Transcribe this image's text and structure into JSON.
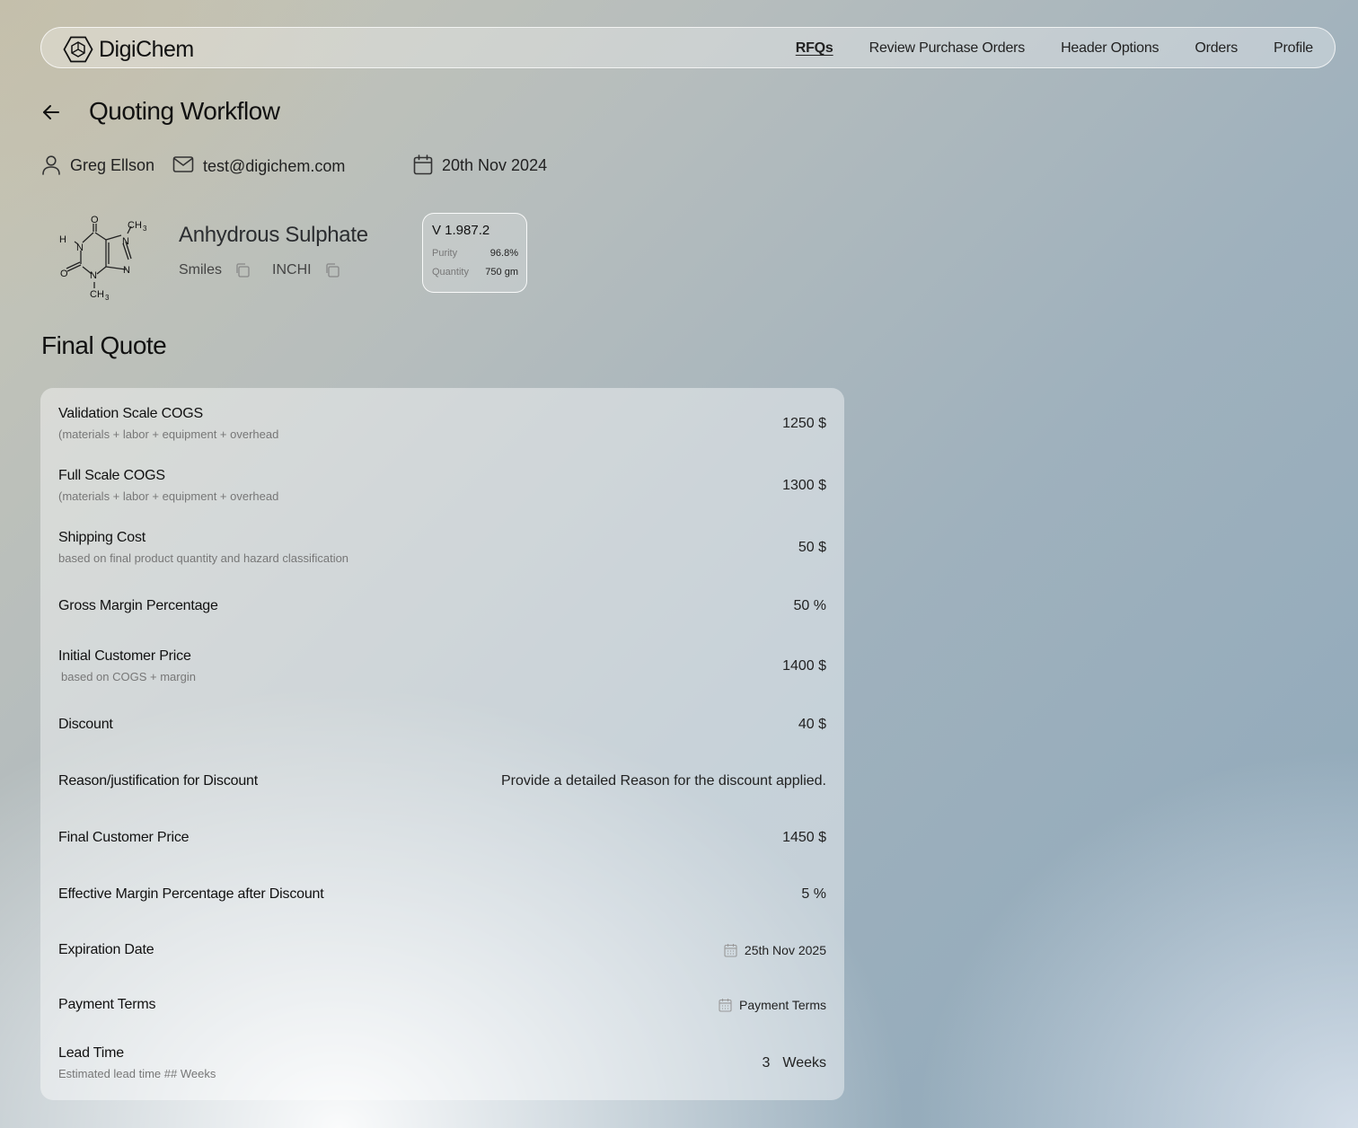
{
  "app": {
    "name": "DigiChem"
  },
  "nav": {
    "items": [
      "RFQs",
      "Review Purchase Orders",
      "Header Options",
      "Orders",
      "Profile"
    ]
  },
  "page": {
    "title": "Quoting Workflow"
  },
  "customer": {
    "name": "Greg Ellson",
    "email": "test@digichem.com",
    "date": "20th Nov 2024"
  },
  "compound": {
    "name": "Anhydrous Sulphate",
    "smiles_label": "Smiles",
    "inchi_label": "INCHI"
  },
  "version": {
    "label": "V 1.987.2",
    "purity_label": "Purity",
    "purity": "96.8%",
    "quantity_label": "Quantity",
    "quantity": "750 gm"
  },
  "molecule_labels": {
    "o": "O",
    "n": "N",
    "h": "H",
    "ch3": "CH",
    "sub3": "3"
  },
  "final_quote": {
    "title": "Final Quote",
    "rows": [
      {
        "label": "Validation Scale COGS",
        "sub": "(materials + labor + equipment + overhead",
        "value": "1250 $"
      },
      {
        "label": "Full Scale COGS",
        "sub": "(materials + labor + equipment + overhead",
        "value": "1300 $"
      },
      {
        "label": "Shipping Cost",
        "sub": "based on final product quantity and hazard classification",
        "value": "50 $"
      },
      {
        "label": "Gross Margin Percentage",
        "value": "50 %"
      },
      {
        "label": "Initial Customer Price",
        "sub": "based on COGS + margin",
        "value": "1400 $"
      },
      {
        "label": "Discount",
        "value": "40 $"
      },
      {
        "label": "Reason/justification for Discount",
        "value": "Provide a detailed Reason for the discount applied."
      },
      {
        "label": "Final Customer Price",
        "value": "1450 $"
      },
      {
        "label": "Effective Margin Percentage after Discount",
        "value": "5 %"
      },
      {
        "label": "Expiration Date",
        "value": "25th Nov 2025"
      },
      {
        "label": "Payment Terms",
        "value": "Payment Terms"
      },
      {
        "label": "Lead Time",
        "sub": "Estimated lead time ## Weeks",
        "value_num": "3",
        "value_unit": "Weeks"
      }
    ]
  }
}
